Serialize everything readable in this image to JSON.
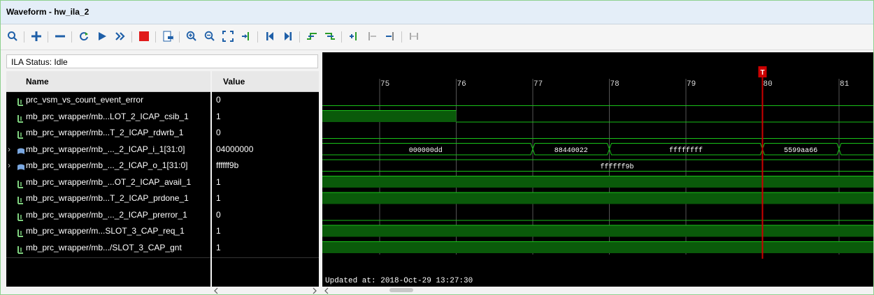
{
  "window": {
    "title": "Waveform - hw_ila_2"
  },
  "toolbar": {
    "buttons": [
      "search-icon",
      "add-icon",
      "remove-icon",
      "refresh-icon",
      "run-trigger-icon",
      "run-immediate-icon",
      "stop-icon",
      "export-icon",
      "zoom-in-icon",
      "zoom-out-icon",
      "zoom-fit-icon",
      "go-to-cursor-icon",
      "go-to-start-icon",
      "go-to-end-icon",
      "prev-transition-icon",
      "next-transition-icon",
      "add-marker-icon",
      "prev-marker-icon",
      "next-marker-icon",
      "swap-cursors-icon"
    ]
  },
  "status": {
    "text": "ILA Status: Idle"
  },
  "columns": {
    "name": "Name",
    "value": "Value"
  },
  "signals": [
    {
      "name": "prc_vsm_vs_count_event_error",
      "value": "0",
      "bus": false
    },
    {
      "name": "mb_prc_wrapper/mb...LOT_2_ICAP_csib_1",
      "value": "1",
      "bus": false
    },
    {
      "name": "mb_prc_wrapper/mb...T_2_ICAP_rdwrb_1",
      "value": "0",
      "bus": false
    },
    {
      "name": "mb_prc_wrapper/mb_..._2_ICAP_i_1[31:0]",
      "value": "04000000",
      "bus": true
    },
    {
      "name": "mb_prc_wrapper/mb_..._2_ICAP_o_1[31:0]",
      "value": "ffffff9b",
      "bus": true
    },
    {
      "name": "mb_prc_wrapper/mb_...OT_2_ICAP_avail_1",
      "value": "1",
      "bus": false
    },
    {
      "name": "mb_prc_wrapper/mb...T_2_ICAP_prdone_1",
      "value": "1",
      "bus": false
    },
    {
      "name": "mb_prc_wrapper/mb_..._2_ICAP_prerror_1",
      "value": "0",
      "bus": false
    },
    {
      "name": "mb_prc_wrapper/m...SLOT_3_CAP_req_1",
      "value": "1",
      "bus": false
    },
    {
      "name": "mb_prc_wrapper/mb.../SLOT_3_CAP_gnt",
      "value": "1",
      "bus": false
    }
  ],
  "timeline": {
    "ticks": [
      "75",
      "76",
      "77",
      "78",
      "79",
      "80",
      "81"
    ],
    "trigger_marker": "T",
    "updated": "Updated at: 2018-Oct-29 13:27:30"
  },
  "bus_i_segments": [
    "000000dd",
    "88440022",
    "ffffffff",
    "5599aa66"
  ],
  "bus_o_segments": [
    "ffffff9b"
  ],
  "colors": {
    "wave_green": "#19c119",
    "high_fill": "#0a5a0a",
    "cursor": "#cc0000",
    "grid": "#555555"
  }
}
